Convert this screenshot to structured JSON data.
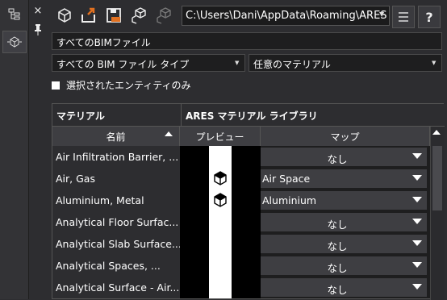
{
  "panel": {
    "path": "C:\\Users\\Dani\\AppData\\Roaming\\ARES",
    "scope_combo": "すべてのBIMファイル",
    "type_combo": "すべての BIM ファイル タイプ",
    "material_combo": "任意のマテリアル",
    "checkbox_label": "選択されたエンティティのみ",
    "close_glyph": "×",
    "pin_glyph": "📌",
    "help_label": "?"
  },
  "table": {
    "group_left": "マテリアル",
    "group_right": "ARES マテリアル ライブラリ",
    "col_name": "名前",
    "col_preview": "プレビュー",
    "col_map": "マップ",
    "rows": [
      {
        "name": "Air Infiltration Barrier, ...",
        "map": "なし",
        "preview": false,
        "centered": true
      },
      {
        "name": "Air, Gas",
        "map": "Air Space",
        "preview": true,
        "centered": false
      },
      {
        "name": "Aluminium, Metal",
        "map": "Aluminium",
        "preview": true,
        "centered": false
      },
      {
        "name": "Analytical Floor Surfac...",
        "map": "なし",
        "preview": false,
        "centered": true
      },
      {
        "name": "Analytical Slab Surface...",
        "map": "なし",
        "preview": false,
        "centered": true
      },
      {
        "name": "Analytical Spaces, ...",
        "map": "なし",
        "preview": false,
        "centered": true
      },
      {
        "name": "Analytical Surface - Air...",
        "map": "なし",
        "preview": false,
        "centered": true
      }
    ]
  },
  "icons": {
    "sidebar": [
      "tree-structure-icon",
      "bim-cube-icon"
    ],
    "toolbar": [
      "cube-icon",
      "export-icon",
      "save-icon",
      "multi-cube-icon",
      "multi-cube-disabled-icon"
    ],
    "right": [
      "menu-icon",
      "help-icon"
    ]
  }
}
